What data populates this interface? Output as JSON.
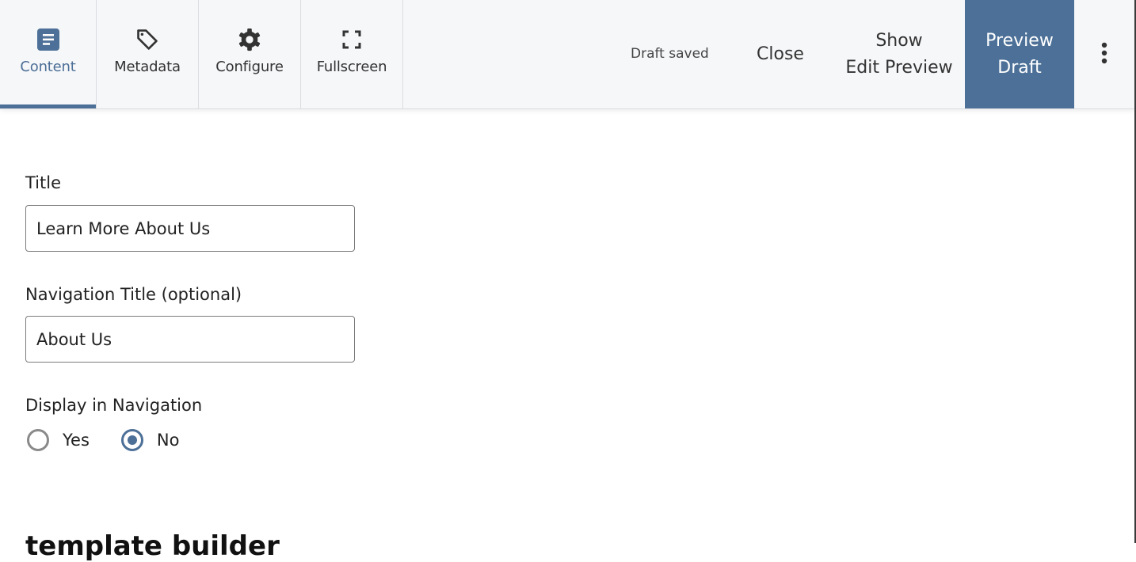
{
  "toolbar": {
    "tabs": [
      {
        "label": "Content",
        "icon": "document-icon",
        "active": true
      },
      {
        "label": "Metadata",
        "icon": "tag-icon",
        "active": false
      },
      {
        "label": "Configure",
        "icon": "gear-icon",
        "active": false
      },
      {
        "label": "Fullscreen",
        "icon": "fullscreen-icon",
        "active": false
      }
    ],
    "status": "Draft saved",
    "close_label": "Close",
    "show_edit_preview": {
      "line1": "Show",
      "line2": "Edit Preview"
    },
    "preview_draft": {
      "line1": "Preview",
      "line2": "Draft"
    },
    "more_icon": "more-vertical-icon"
  },
  "form": {
    "title": {
      "label": "Title",
      "value": "Learn More About Us"
    },
    "nav_title": {
      "label": "Navigation Title (optional)",
      "value": "About Us"
    },
    "display_in_nav": {
      "label": "Display in Navigation",
      "options": [
        {
          "label": "Yes",
          "checked": false
        },
        {
          "label": "No",
          "checked": true
        }
      ]
    },
    "section_heading": "template builder"
  },
  "colors": {
    "accent": "#4c7097",
    "toolbar_bg": "#f6f7f9"
  }
}
